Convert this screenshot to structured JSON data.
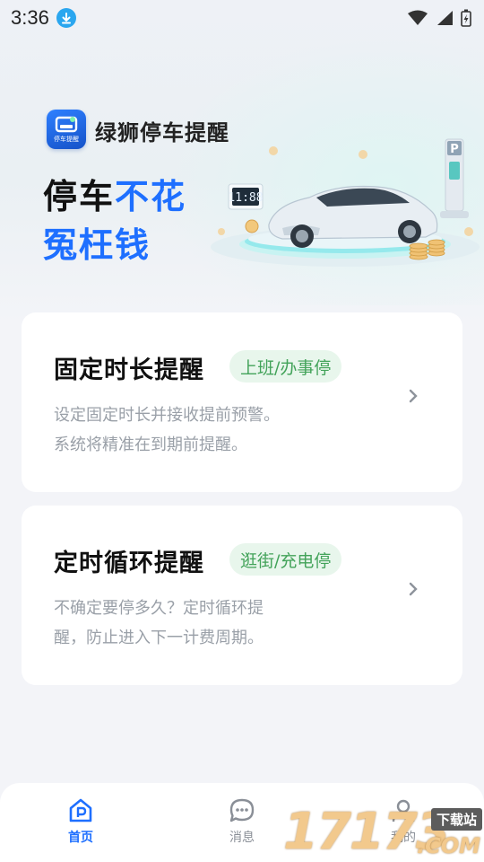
{
  "status_bar": {
    "time": "3:36",
    "icons": [
      "download-icon",
      "wifi-icon",
      "signal-icon",
      "battery-charging-icon"
    ]
  },
  "header": {
    "app_name": "绿狮停车提醒",
    "logo_caption": "停车提醒",
    "slogan_line1_part1": "停车",
    "slogan_line1_part2": "不花",
    "slogan_line2": "冤枉钱",
    "clock_display": "11:88",
    "parking_sign": "P"
  },
  "cards": [
    {
      "title": "固定时长提醒",
      "tag": "上班/办事停",
      "desc_line1": "设定固定时长并接收提前预警。",
      "desc_line2": "系统将精准在到期前提醒。"
    },
    {
      "title": "定时循环提醒",
      "tag": "逛街/充电停",
      "desc_line1": "不确定要停多久？定时循环提",
      "desc_line2": "醒，防止进入下一计费周期。"
    }
  ],
  "tabbar": {
    "home": "首页",
    "messages": "消息",
    "mine": "我的"
  },
  "watermark": {
    "digits": "17173",
    "sub": "下载站",
    "suffix": ".COM"
  },
  "colors": {
    "accent": "#1e6fff",
    "tag_bg": "#e8f6ec",
    "tag_text": "#43a35a",
    "desc_text": "#9aa0a8"
  }
}
